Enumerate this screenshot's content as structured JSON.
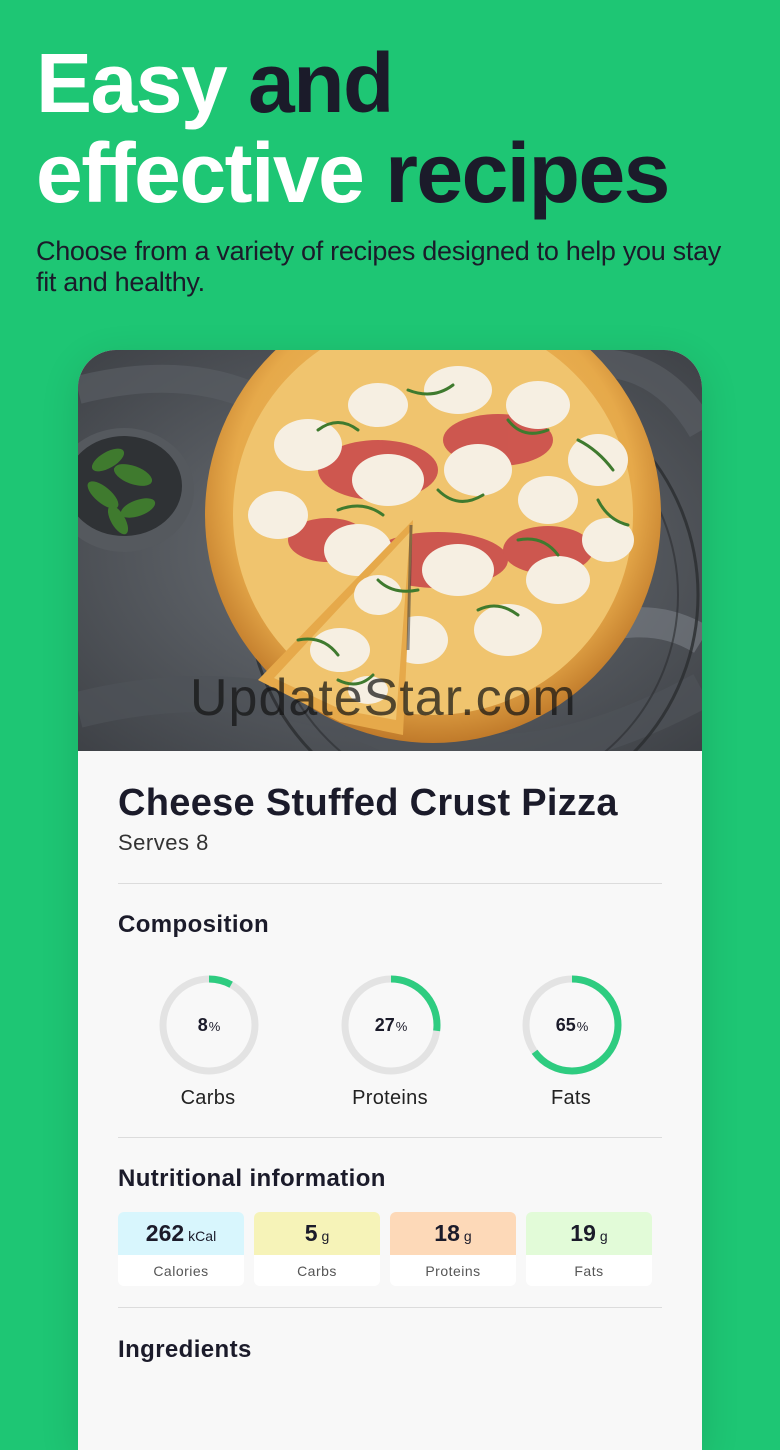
{
  "headline": {
    "line1_white": "Easy",
    "line1_dark": "and",
    "line2_white": "effective",
    "line2_dark": "recipes"
  },
  "subtitle": "Choose from a variety of recipes designed to help you stay fit and healthy.",
  "watermark": "UpdateStar.com",
  "recipe": {
    "title": "Cheese Stuffed Crust Pizza",
    "serves": "Serves 8"
  },
  "composition": {
    "heading": "Composition",
    "items": [
      {
        "label": "Carbs",
        "value": "8",
        "unit": "%",
        "fraction": 0.08
      },
      {
        "label": "Proteins",
        "value": "27",
        "unit": "%",
        "fraction": 0.27
      },
      {
        "label": "Fats",
        "value": "65",
        "unit": "%",
        "fraction": 0.65
      }
    ]
  },
  "nutrition": {
    "heading": "Nutritional information",
    "items": [
      {
        "label": "Calories",
        "value": "262",
        "unit": "kCal",
        "color": "#d8f6fd"
      },
      {
        "label": "Carbs",
        "value": "5",
        "unit": "g",
        "color": "#f6f3b8"
      },
      {
        "label": "Proteins",
        "value": "18",
        "unit": "g",
        "color": "#fdd9b8"
      },
      {
        "label": "Fats",
        "value": "19",
        "unit": "g",
        "color": "#e2fbd8"
      }
    ]
  },
  "ingredients": {
    "heading": "Ingredients"
  },
  "colors": {
    "background": "#1ec674",
    "headline_dark": "#1b1b2a",
    "ring_track": "#e3e3e3",
    "ring_fill": "#2ecc80"
  }
}
